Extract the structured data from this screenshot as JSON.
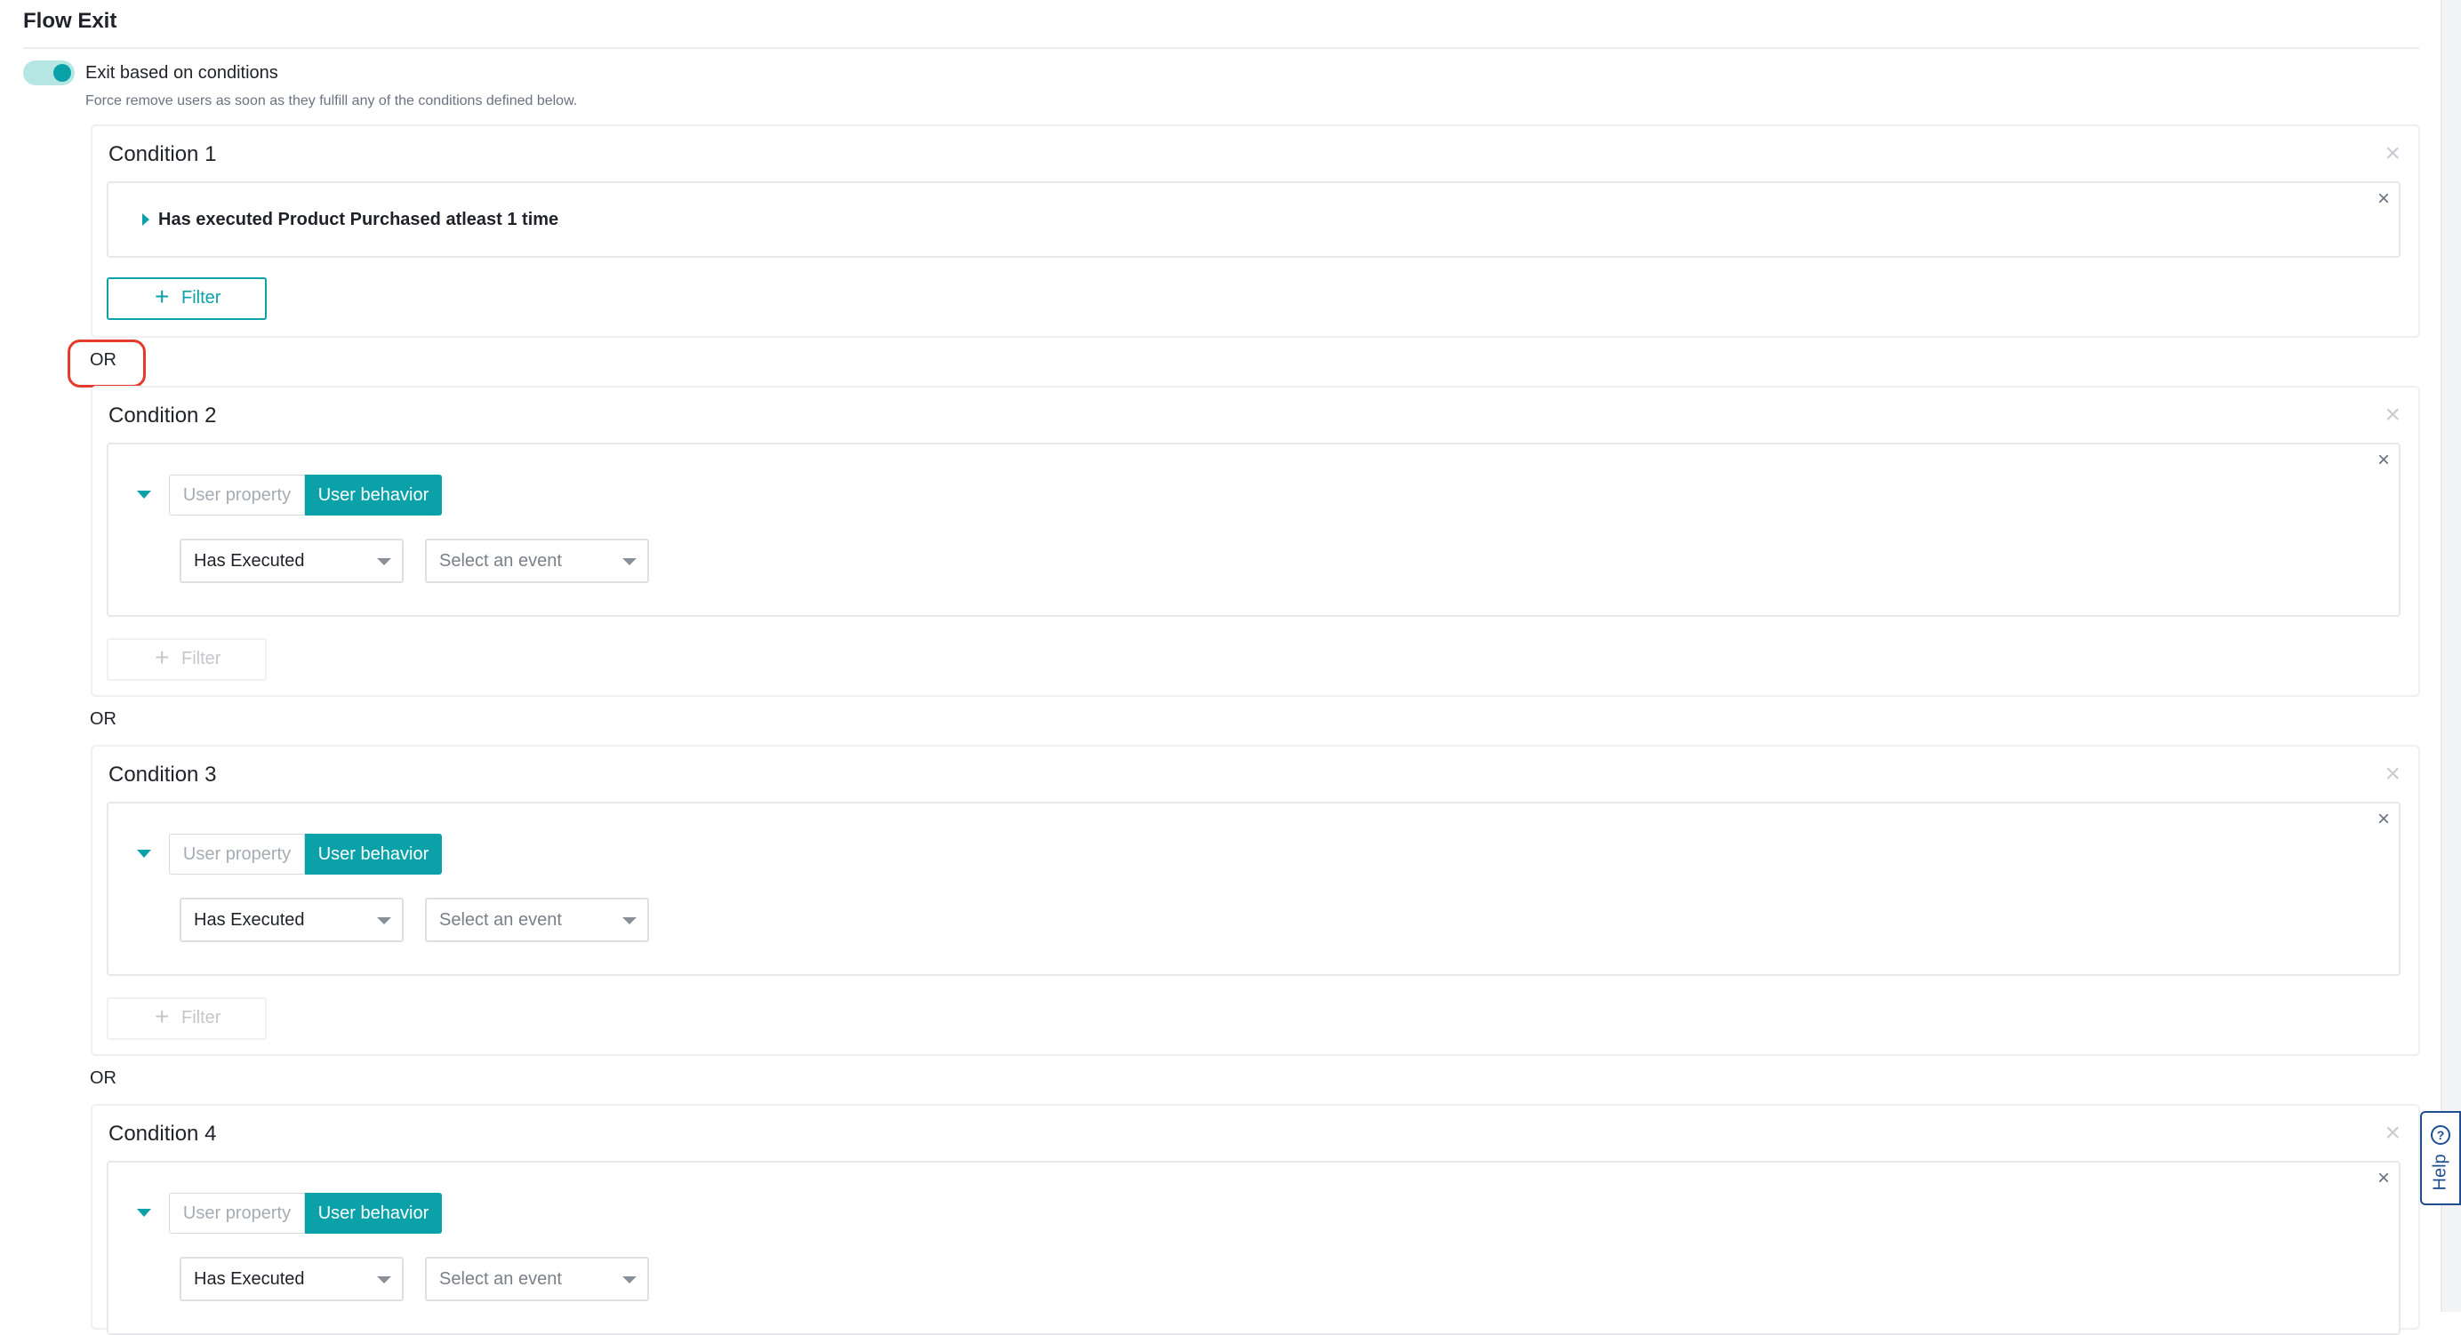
{
  "header": {
    "title": "Flow Exit"
  },
  "exit_toggle": {
    "label": "Exit based on conditions",
    "description": "Force remove users as soon as they fulfill any of the conditions defined below.",
    "enabled": true
  },
  "separator_label": "OR",
  "filter_button_label": "Filter",
  "close_glyph": "×",
  "conditions": [
    {
      "title": "Condition 1",
      "summary": "Has executed Product Purchased atleast 1 time",
      "expanded": false,
      "filter_enabled": true
    },
    {
      "title": "Condition 2",
      "expanded": true,
      "tabs": [
        "User property",
        "User behavior"
      ],
      "active_tab": "User behavior",
      "operator_value": "Has Executed",
      "event_placeholder": "Select an event",
      "filter_enabled": false
    },
    {
      "title": "Condition 3",
      "expanded": true,
      "tabs": [
        "User property",
        "User behavior"
      ],
      "active_tab": "User behavior",
      "operator_value": "Has Executed",
      "event_placeholder": "Select an event",
      "filter_enabled": false
    },
    {
      "title": "Condition 4",
      "expanded": true,
      "tabs": [
        "User property",
        "User behavior"
      ],
      "active_tab": "User behavior",
      "operator_value": "Has Executed",
      "event_placeholder": "Select an event"
    }
  ],
  "help_tab": {
    "label": "Help",
    "icon": "question-circle-icon"
  },
  "colors": {
    "accent": "#0aa2a8",
    "highlight": "#e53b2c",
    "help": "#1f4f8f"
  }
}
